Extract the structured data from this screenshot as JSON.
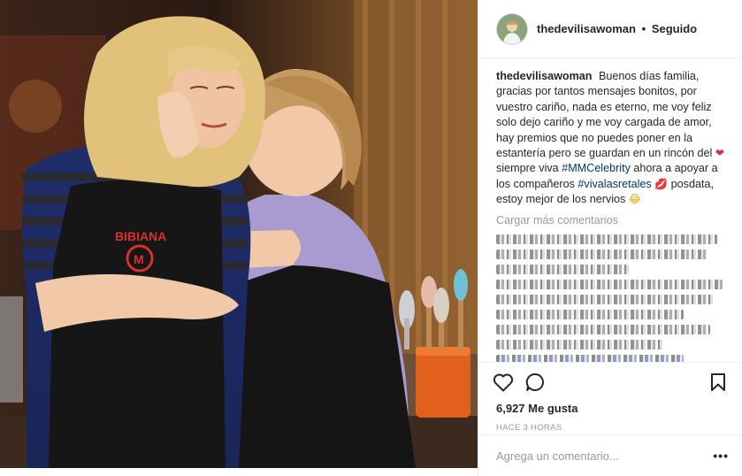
{
  "post": {
    "photo_badge_text": "BIBIANA",
    "username": "thedevilisawoman",
    "separator": "•",
    "follow_status": "Seguido",
    "caption": {
      "part1": "Buenos días familia, gracias por tantos mensajes bonitos, por vuestro cariño, nada es eterno, me voy feliz solo dejo cariño y me voy cargada de amor, hay premios que no puedes poner en la estantería pero se guardan en un rincón del",
      "part2": "siempre viva",
      "hashtag1": "#MMCelebrity",
      "part3": "ahora a apoyar a los compañeros",
      "hashtag2": "#vivalasretales",
      "part4": "posdata, estoy mejor de los nervios"
    },
    "emojis": {
      "heart": "❤",
      "lips": "💋",
      "laugh": "😂"
    },
    "load_more_comments": "Cargar más comentarios",
    "likes": "6,927 Me gusta",
    "timestamp": "HACE 3 HORAS",
    "comment_placeholder": "Agrega un comentario...",
    "more_options": "•••"
  },
  "icons": {
    "like": "heart-outline-icon",
    "comment": "speech-bubble-icon",
    "save": "bookmark-icon",
    "more": "ellipsis-icon"
  },
  "colors": {
    "hashtag": "#003569",
    "muted": "#999999",
    "text": "#262626",
    "border": "#efefef"
  }
}
